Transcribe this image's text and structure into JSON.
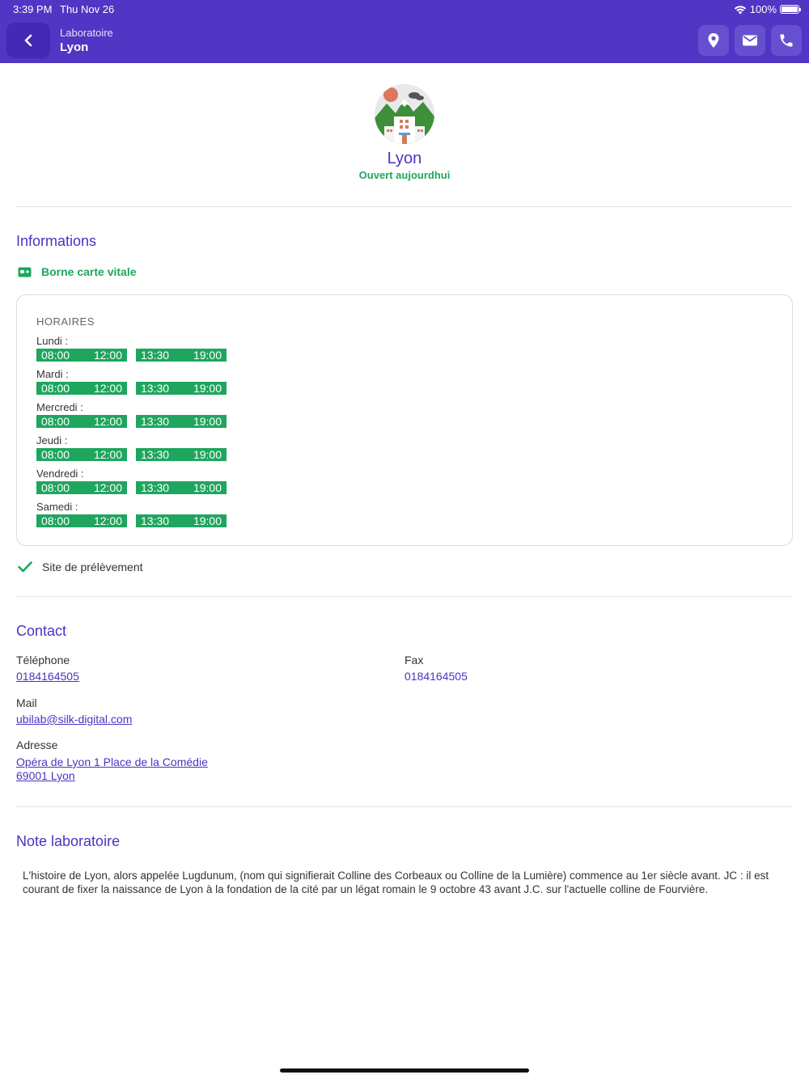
{
  "status_bar": {
    "time": "3:39 PM",
    "date": "Thu Nov 26",
    "battery": "100%"
  },
  "nav": {
    "subtitle": "Laboratoire",
    "title": "Lyon",
    "back_icon": "chevron-left-icon",
    "actions": [
      "location-pin-icon",
      "mail-icon",
      "phone-icon"
    ]
  },
  "lab": {
    "name": "Lyon",
    "status": "Ouvert aujourdhui"
  },
  "informations": {
    "title": "Informations",
    "vitale_label": "Borne carte vitale",
    "hours_title": "HORAIRES",
    "days": [
      {
        "label": "Lundi :",
        "am_open": "08:00",
        "am_close": "12:00",
        "pm_open": "13:30",
        "pm_close": "19:00"
      },
      {
        "label": "Mardi :",
        "am_open": "08:00",
        "am_close": "12:00",
        "pm_open": "13:30",
        "pm_close": "19:00"
      },
      {
        "label": "Mercredi :",
        "am_open": "08:00",
        "am_close": "12:00",
        "pm_open": "13:30",
        "pm_close": "19:00"
      },
      {
        "label": "Jeudi :",
        "am_open": "08:00",
        "am_close": "12:00",
        "pm_open": "13:30",
        "pm_close": "19:00"
      },
      {
        "label": "Vendredi :",
        "am_open": "08:00",
        "am_close": "12:00",
        "pm_open": "13:30",
        "pm_close": "19:00"
      },
      {
        "label": "Samedi :",
        "am_open": "08:00",
        "am_close": "12:00",
        "pm_open": "13:30",
        "pm_close": "19:00"
      }
    ],
    "prelevement_label": "Site de prélèvement"
  },
  "contact": {
    "title": "Contact",
    "phone_label": "Téléphone",
    "phone_value": "0184164505",
    "fax_label": "Fax",
    "fax_value": "0184164505",
    "mail_label": "Mail",
    "mail_value": "ubilab@silk-digital.com",
    "address_label": "Adresse",
    "address_line1": "Opéra de Lyon 1 Place de la Comédie",
    "address_line2": "69001 Lyon"
  },
  "note": {
    "title": "Note laboratoire",
    "text": "L'histoire de Lyon, alors appelée Lugdunum, (nom qui signifierait Colline des Corbeaux ou Colline de la Lumière) commence au 1er siècle avant. JC : il est courant de fixer la naissance de Lyon à la fondation de la cité par un légat romain le 9 octobre 43 avant J.C. sur l'actuelle colline de Fourvière."
  },
  "colors": {
    "primary": "#5135c4",
    "accent_green": "#1fa65e",
    "link": "#4f31c4"
  }
}
